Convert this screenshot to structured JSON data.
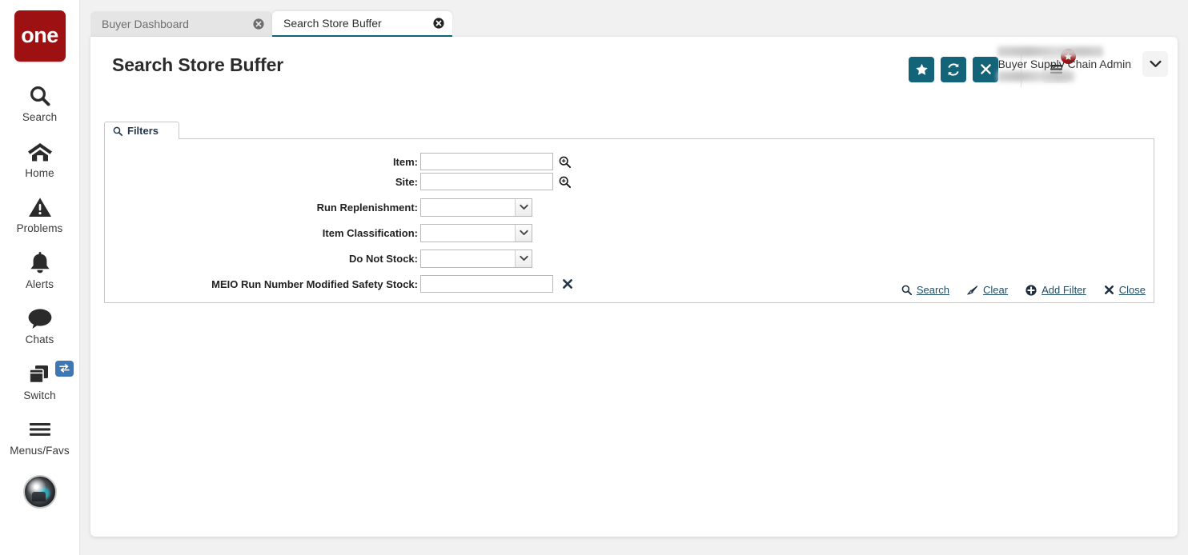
{
  "brand": {
    "logo_text": "one",
    "logo_color": "#9e1113"
  },
  "theme": {
    "accent": "#136379",
    "link": "#1f4e66",
    "badge": "#9e1113",
    "switch_badge": "#3f77b4"
  },
  "sidebar": {
    "items": [
      {
        "label": "Search",
        "icon": "search-icon"
      },
      {
        "label": "Home",
        "icon": "home-icon"
      },
      {
        "label": "Problems",
        "icon": "warning-triangle-icon"
      },
      {
        "label": "Alerts",
        "icon": "bell-icon"
      },
      {
        "label": "Chats",
        "icon": "chat-bubble-icon"
      },
      {
        "label": "Switch",
        "icon": "windows-stack-icon",
        "badge_icon": "exchange-arrows-icon"
      },
      {
        "label": "Menus/Favs",
        "icon": "hamburger-icon"
      }
    ],
    "avatar": "user-avatar"
  },
  "tabs": [
    {
      "label": "Buyer Dashboard",
      "active": false,
      "close_icon": "close-circle-icon"
    },
    {
      "label": "Search Store Buffer",
      "active": true,
      "close_icon": "close-circle-icon"
    }
  ],
  "header": {
    "title": "Search Store Buffer",
    "actions": [
      {
        "name": "favorite-button",
        "icon": "star-icon"
      },
      {
        "name": "refresh-button",
        "icon": "refresh-icon"
      },
      {
        "name": "close-button",
        "icon": "x-icon"
      }
    ],
    "menu_button": {
      "icon": "hamburger-icon",
      "badge_icon": "star-icon"
    },
    "user": {
      "role": "Buyer Supply Chain Admin",
      "caret_icon": "chevron-down-icon"
    }
  },
  "filters": {
    "tab_label": "Filters",
    "tab_icon": "search-icon",
    "fields": [
      {
        "label": "Item:",
        "type": "text",
        "value": "",
        "icon": "lookup-magnifier-icon"
      },
      {
        "label": "Site:",
        "type": "text",
        "value": "",
        "icon": "lookup-magnifier-icon"
      },
      {
        "label": "Run Replenishment:",
        "type": "select",
        "value": "",
        "icon": "chevron-down-icon"
      },
      {
        "label": "Item Classification:",
        "type": "select",
        "value": "",
        "icon": "chevron-down-icon"
      },
      {
        "label": "Do Not Stock:",
        "type": "select",
        "value": "",
        "icon": "chevron-down-icon"
      },
      {
        "label": "MEIO Run Number Modified Safety Stock:",
        "type": "text",
        "value": "",
        "icon": "remove-x-icon"
      }
    ],
    "actions": [
      {
        "label": "Search",
        "icon": "search-icon"
      },
      {
        "label": "Clear",
        "icon": "eraser-icon"
      },
      {
        "label": "Add Filter",
        "icon": "plus-circle-icon"
      },
      {
        "label": "Close",
        "icon": "x-icon"
      }
    ]
  }
}
